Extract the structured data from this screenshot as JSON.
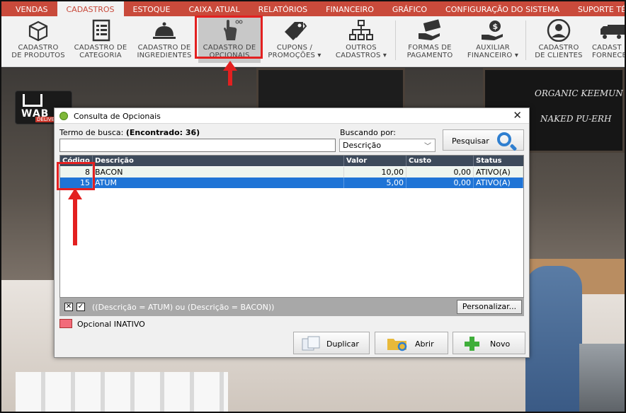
{
  "menu": {
    "tabs": [
      {
        "label": "VENDAS"
      },
      {
        "label": "CADASTROS"
      },
      {
        "label": "ESTOQUE"
      },
      {
        "label": "CAIXA ATUAL"
      },
      {
        "label": "RELATÓRIOS"
      },
      {
        "label": "FINANCEIRO"
      },
      {
        "label": "GRÁFICO"
      },
      {
        "label": "CONFIGURAÇÃO DO SISTEMA"
      },
      {
        "label": "SUPORTE TÉCNI"
      }
    ],
    "active": "CADASTROS"
  },
  "ribbon": {
    "buttons": [
      {
        "label": "CADASTRO\nDE PRODUTOS",
        "icon": "box-icon"
      },
      {
        "label": "CADASTRO DE\nCATEGORIA",
        "icon": "list-icon"
      },
      {
        "label": "CADASTRO DE\nINGREDIENTES",
        "icon": "cloche-icon"
      },
      {
        "label": "CADASTRO DE\nOPCIONAIS",
        "icon": "hand-pointer-icon"
      },
      {
        "label": "CUPONS /\nPROMOÇÕES ▾",
        "icon": "tag-icon"
      },
      {
        "label": "OUTROS\nCADASTROS ▾",
        "icon": "hierarchy-icon"
      },
      {
        "label": "FORMAS DE\nPAGAMENTO",
        "icon": "money-hand-icon"
      },
      {
        "label": "AUXILIAR\nFINANCEIRO ▾",
        "icon": "dollar-hand-icon"
      },
      {
        "label": "CADASTRO\nDE CLIENTES",
        "icon": "person-icon"
      },
      {
        "label": "CADAST\nFORNECE",
        "icon": "truck-icon"
      }
    ]
  },
  "background": {
    "board1_text": "",
    "board2_lines": [
      "ORGANIC KEEMUN",
      "NAKED PU-ERH"
    ]
  },
  "logo": {
    "text": "WAB",
    "sub": "DELIVE"
  },
  "dialog": {
    "title": "Consulta de Opcionais",
    "search_label": "Termo de busca:",
    "found_label": "(Encontrado: 36)",
    "search_value": "",
    "search_by_label": "Buscando por:",
    "search_by_value": "Descrição",
    "search_button": "Pesquisar",
    "columns": [
      "Código",
      "Descrição",
      "Valor",
      "Custo",
      "Status"
    ],
    "rows": [
      {
        "codigo": "8",
        "descricao": "BACON",
        "valor": "10,00",
        "custo": "0,00",
        "status": "ATIVO(A)"
      },
      {
        "codigo": "15",
        "descricao": "ATUM",
        "valor": "5,00",
        "custo": "0,00",
        "status": "ATIVO(A)"
      }
    ],
    "filter_text": "((Descrição = ATUM) ou (Descrição = BACON))",
    "customize_button": "Personalizar...",
    "legend_text": "Opcional INATIVO",
    "legend_color": "#f26b7a",
    "buttons": {
      "duplicate": "Duplicar",
      "open": "Abrir",
      "new": "Novo"
    }
  },
  "colors": {
    "menu_bg": "#c94a3b",
    "selected_row": "#1f74d6",
    "annotation": "#e32020"
  }
}
